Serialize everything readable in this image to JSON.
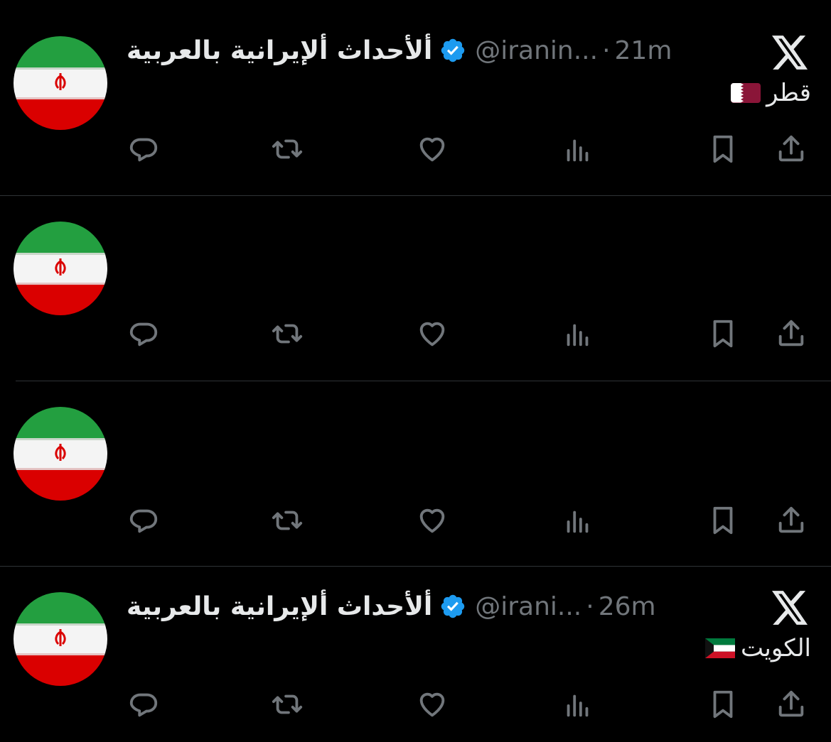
{
  "colors": {
    "background": "#000000",
    "text": "#e7e9ea",
    "secondary": "#71767b",
    "verified": "#1d9bf0",
    "divider": "#2f3336",
    "flag_green": "#239f40",
    "flag_red": "#da0000"
  },
  "tweets": [
    {
      "display_name": "ألأحداث ألإيرانية بالعربية",
      "handle": "@iranin...",
      "separator": "·",
      "time": "21m",
      "text": "قطر",
      "flag": "qatar-flag",
      "show_header": true
    },
    {
      "show_header": false
    },
    {
      "show_header": false
    },
    {
      "display_name": "ألأحداث ألإيرانية بالعربية",
      "handle": "@irani...",
      "separator": "·",
      "time": "26m",
      "text": "الكويت",
      "flag": "kuwait-flag",
      "show_header": true
    }
  ],
  "icons": {
    "avatar": "iran-flag-avatar",
    "verified": "verified-badge-icon",
    "platform": "x-logo-icon",
    "actions": [
      "reply-icon",
      "retweet-icon",
      "like-icon",
      "views-icon",
      "bookmark-icon",
      "share-icon"
    ]
  }
}
